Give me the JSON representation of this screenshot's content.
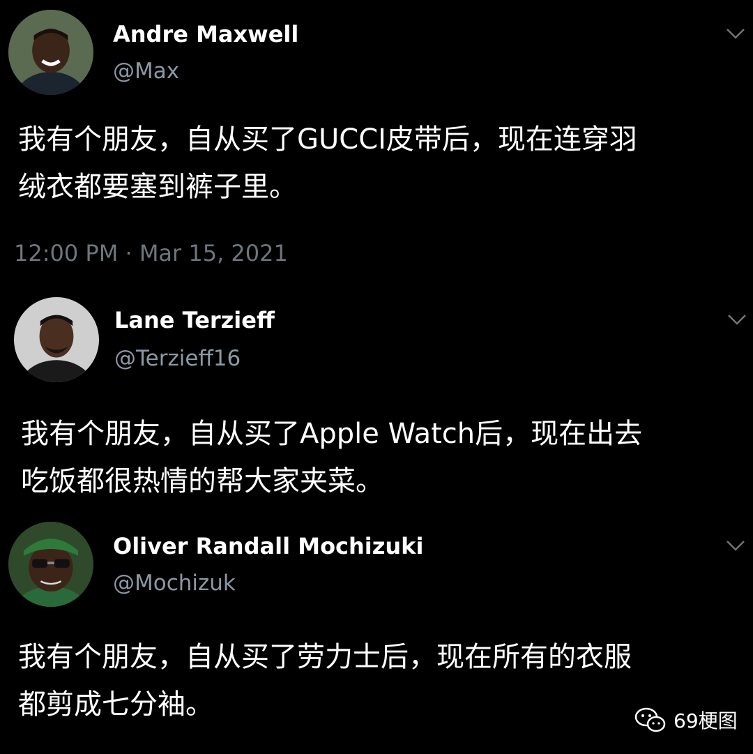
{
  "tweets": [
    {
      "name": "Andre Maxwell",
      "handle": "@Max",
      "text_line1": "我有个朋友，自从买了GUCCI皮带后，现在连穿羽",
      "text_line2": "绒衣都要塞到裤子里。",
      "timestamp": "12:00 PM · Mar 15, 2021"
    },
    {
      "name": "Lane Terzieff",
      "handle": "@Terzieff16",
      "text_line1": "我有个朋友，自从买了Apple Watch后，现在出去",
      "text_line2": "吃饭都很热情的帮大家夹菜。"
    },
    {
      "name": "Oliver Randall Mochizuki",
      "handle": "@Mochizuk",
      "text_line1": "我有个朋友，自从买了劳力士后，现在所有的衣服",
      "text_line2": "都剪成七分袖。"
    }
  ],
  "watermark": {
    "text": "69梗图",
    "icon": "wechat-icon"
  },
  "colors": {
    "background": "#000000",
    "text": "#ffffff",
    "secondary": "#8b98a5",
    "timestamp": "#6e767d"
  }
}
